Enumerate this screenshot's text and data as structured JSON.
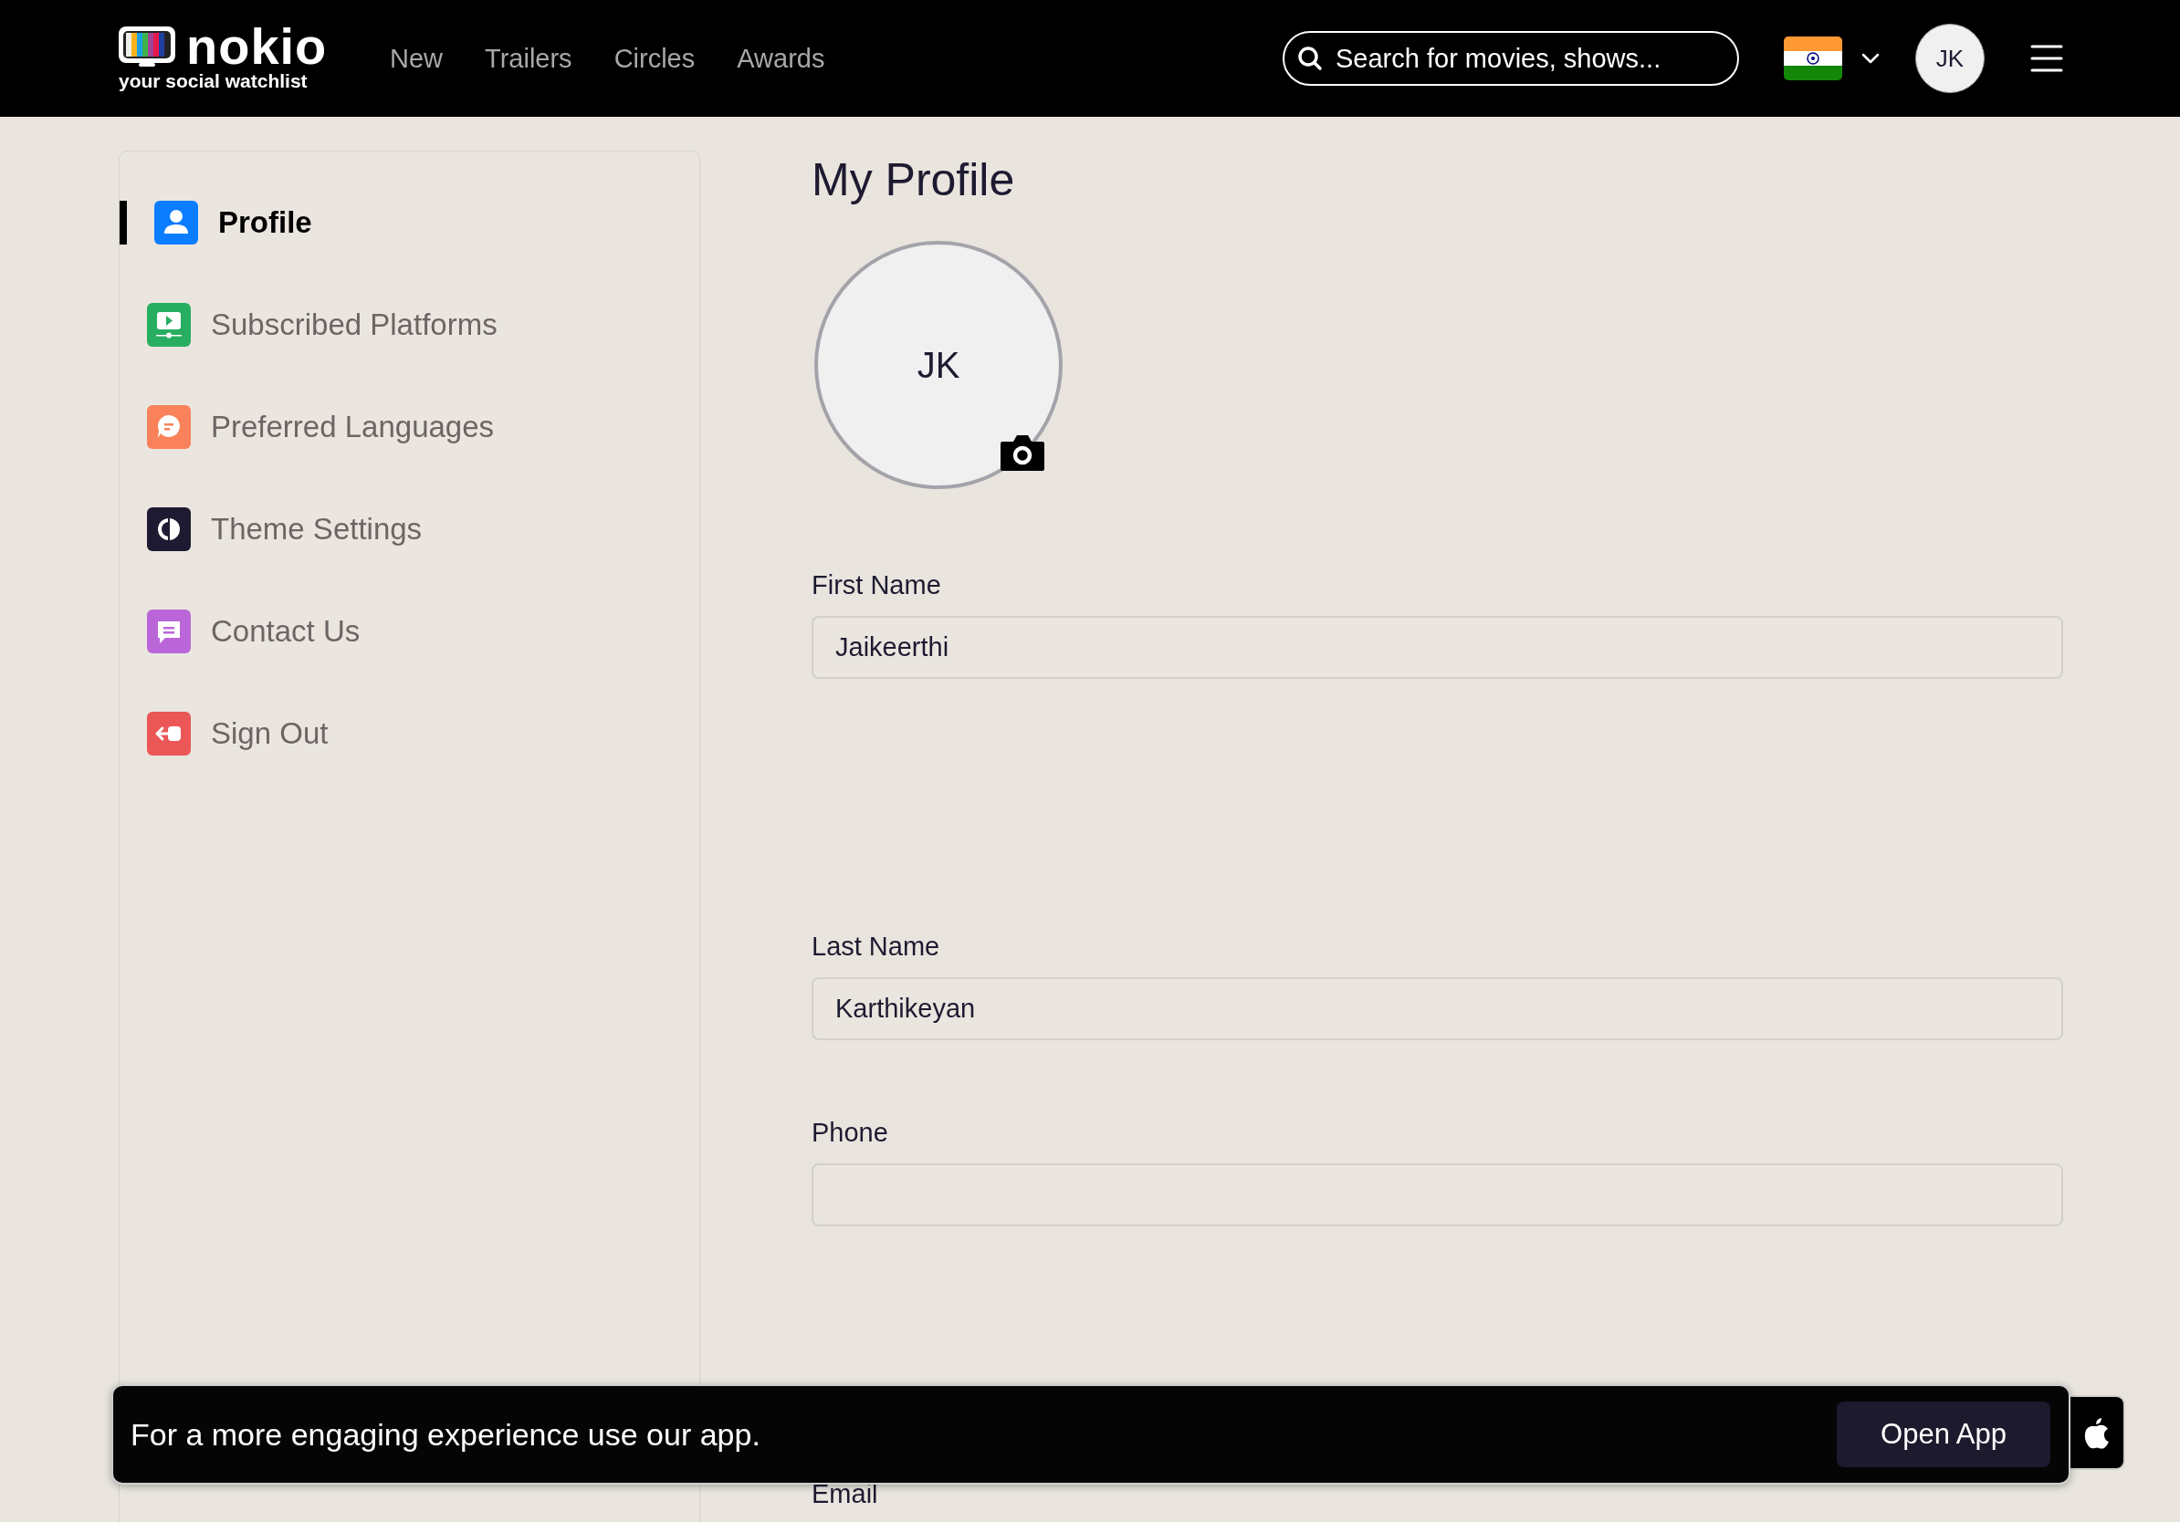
{
  "header": {
    "logo": {
      "name": "nokio",
      "tagline": "your social watchlist"
    },
    "nav": [
      {
        "label": "New"
      },
      {
        "label": "Trailers"
      },
      {
        "label": "Circles"
      },
      {
        "label": "Awards"
      }
    ],
    "search": {
      "placeholder": "Search for movies, shows..."
    },
    "avatar": "JK"
  },
  "sidebar": {
    "items": [
      {
        "label": "Profile",
        "selected": true,
        "kind": "profile",
        "color": "#0a7cff"
      },
      {
        "label": "Subscribed Platforms",
        "selected": false,
        "kind": "platforms",
        "color": "#27ae60"
      },
      {
        "label": "Preferred Languages",
        "selected": false,
        "kind": "languages",
        "color": "#f9825a"
      },
      {
        "label": "Theme Settings",
        "selected": false,
        "kind": "theme",
        "color": "#1d1a31"
      },
      {
        "label": "Contact Us",
        "selected": false,
        "kind": "contact",
        "color": "#bb66d8"
      },
      {
        "label": "Sign Out",
        "selected": false,
        "kind": "signout",
        "color": "#eb5757"
      }
    ]
  },
  "profile": {
    "title": "My Profile",
    "initials": "JK",
    "fields": [
      {
        "label": "First Name",
        "value": "Jaikeerthi"
      },
      {
        "label": "Last Name",
        "value": "Karthikeyan"
      },
      {
        "label": "Phone"
      },
      {
        "label": "Email"
      }
    ]
  },
  "banner": {
    "text": "For a more engaging experience use our app.",
    "button": "Open App"
  }
}
